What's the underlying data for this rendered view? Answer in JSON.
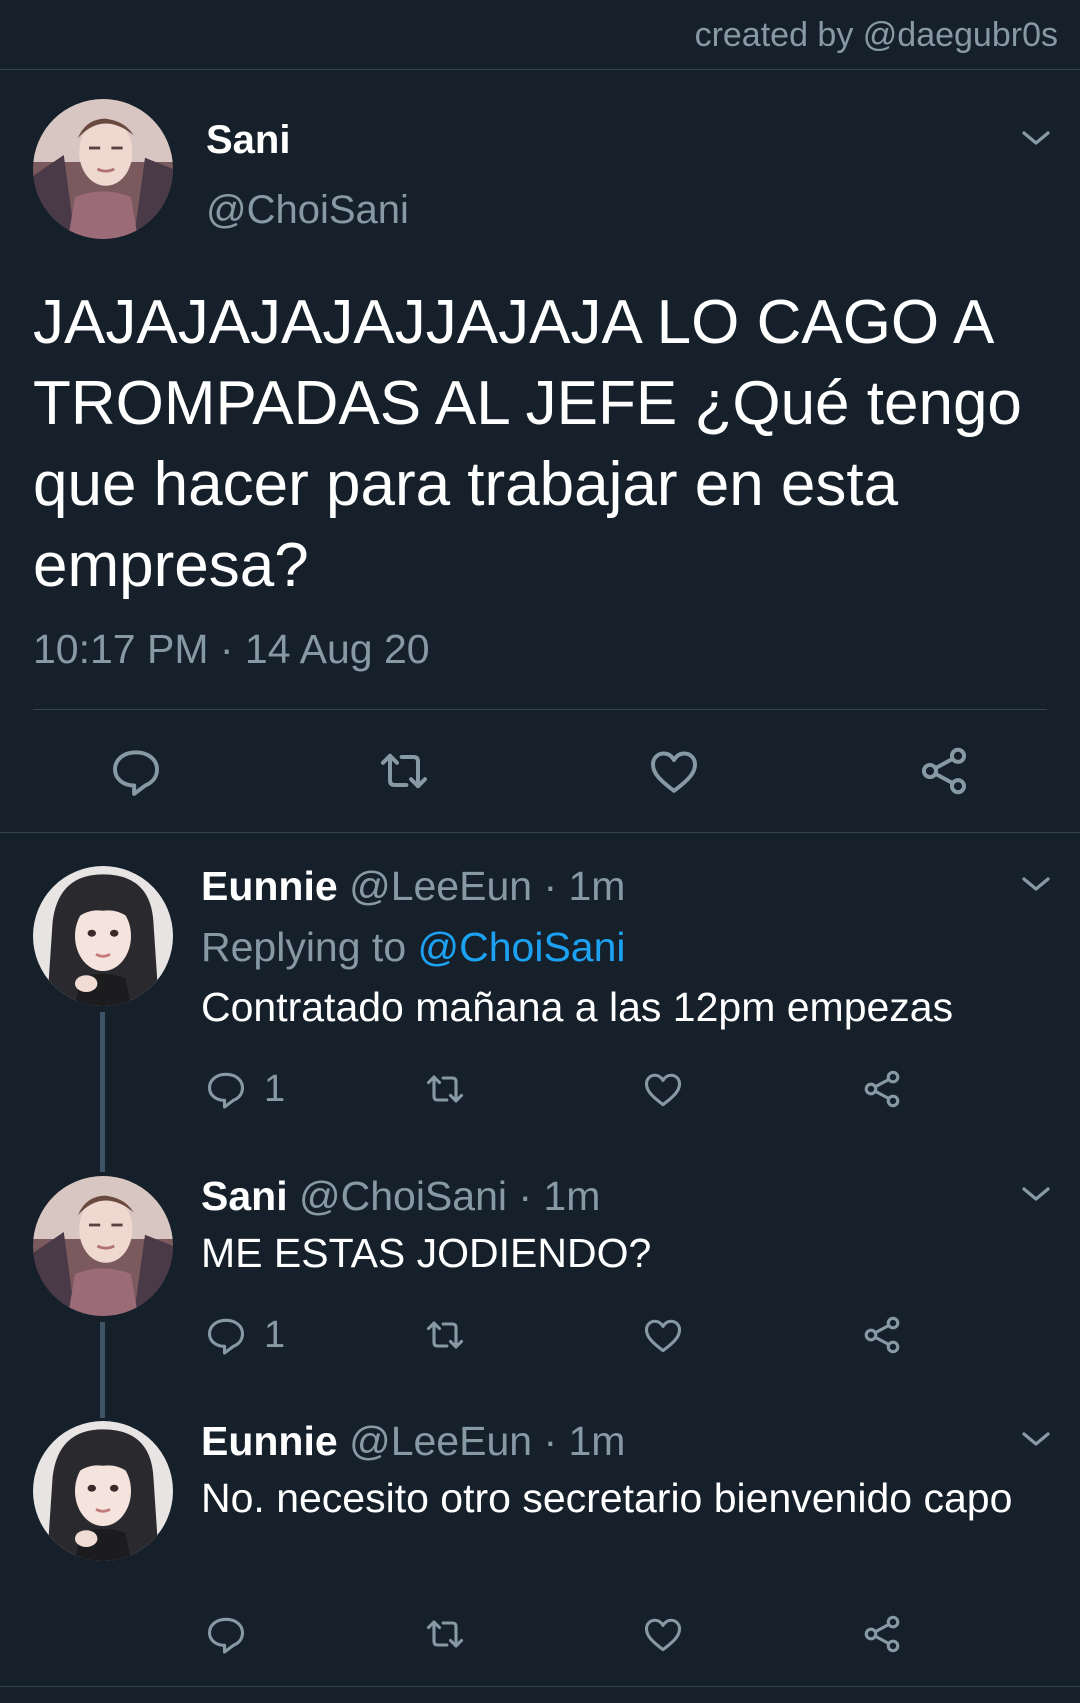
{
  "credit": "created by @daegubr0s",
  "main_tweet": {
    "name": "Sani",
    "handle": "@ChoiSani",
    "text": "JAJAJAJAJAJJAJAJA LO CAGO A TROMPADAS AL JEFE ¿Qué tengo que hacer para trabajar en esta empresa?",
    "time": "10:17 PM · 14 Aug 20"
  },
  "replies": [
    {
      "name": "Eunnie",
      "meta": " @LeeEun · 1m",
      "replying_prefix": "Replying to ",
      "replying_mention": "@ChoiSani",
      "text": "Contratado mañana a las 12pm empezas",
      "reply_count": "1"
    },
    {
      "name": "Sani",
      "meta": " @ChoiSani · 1m",
      "text": "ME ESTAS JODIENDO?",
      "reply_count": "1"
    },
    {
      "name": "Eunnie",
      "meta": " @LeeEun · 1m",
      "text": "No. necesito otro secretario bienvenido capo",
      "reply_count": ""
    }
  ],
  "icons": {
    "reply": "reply-icon",
    "retweet": "retweet-icon",
    "like": "heart-icon",
    "share": "share-icon",
    "more": "chevron-down-icon"
  },
  "colors": {
    "background": "#15202b",
    "secondary_text": "#8899a6",
    "mention": "#1da1f2",
    "divider": "#38444d"
  }
}
